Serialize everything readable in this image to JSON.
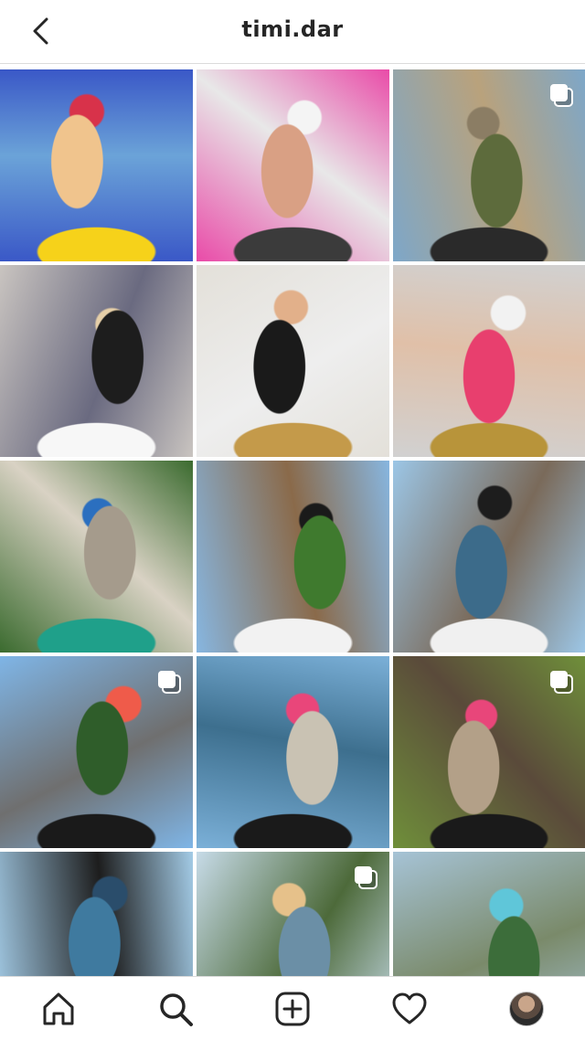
{
  "header": {
    "username": "timi.dar",
    "back_icon": "chevron-left-icon"
  },
  "grid": {
    "tiles": [
      {
        "name": "post-1",
        "multi": false,
        "colors": [
          "#3a58c7",
          "#f0c48d",
          "#d8324a",
          "#f6d21a",
          "#6ba3d8"
        ]
      },
      {
        "name": "post-2",
        "multi": false,
        "colors": [
          "#e94ba8",
          "#d9a084",
          "#f4f4f4",
          "#3b3b3b",
          "#e8e8e8"
        ]
      },
      {
        "name": "post-3",
        "multi": true,
        "colors": [
          "#7da7c9",
          "#5d6b3c",
          "#8b7d64",
          "#2a2a2a",
          "#b9a27c"
        ]
      },
      {
        "name": "post-4",
        "multi": false,
        "colors": [
          "#c9c4c0",
          "#1d1d1d",
          "#e6cfa8",
          "#f7f7f7",
          "#6a6a80"
        ]
      },
      {
        "name": "post-5",
        "multi": false,
        "colors": [
          "#e3e0d9",
          "#1a1a1a",
          "#e2b08a",
          "#c49a4a",
          "#eeeeee"
        ]
      },
      {
        "name": "post-6",
        "multi": false,
        "colors": [
          "#d1d1d1",
          "#e83f6e",
          "#f2f2f2",
          "#b8943a",
          "#e0c0a8"
        ]
      },
      {
        "name": "post-7",
        "multi": false,
        "colors": [
          "#3b6b2f",
          "#a59b8c",
          "#2b6fbf",
          "#1fa08a",
          "#d9d2c4"
        ]
      },
      {
        "name": "post-8",
        "multi": false,
        "colors": [
          "#87b6e0",
          "#3f7a2e",
          "#1a1a1a",
          "#f2f2f2",
          "#8a6a4a"
        ]
      },
      {
        "name": "post-9",
        "multi": false,
        "colors": [
          "#9cc6e6",
          "#3c6b8a",
          "#1d1d1d",
          "#f0f0f0",
          "#7a6a5a"
        ]
      },
      {
        "name": "post-10",
        "multi": true,
        "colors": [
          "#7fb5e6",
          "#2f5d2a",
          "#ef5b4a",
          "#1a1a1a",
          "#6f6f6f"
        ]
      },
      {
        "name": "post-11",
        "multi": false,
        "colors": [
          "#7bb0d8",
          "#c9c2b3",
          "#e9467a",
          "#1a1a1a",
          "#3d6f8e"
        ]
      },
      {
        "name": "post-12",
        "multi": true,
        "colors": [
          "#6f8f3a",
          "#b3a088",
          "#e8467a",
          "#1a1a1a",
          "#5a4a3a"
        ]
      },
      {
        "name": "post-13",
        "multi": false,
        "colors": [
          "#a3cbe6",
          "#3f7a9f",
          "#2a4d6b",
          "#e8c890",
          "#1d1d1d"
        ]
      },
      {
        "name": "post-14",
        "multi": true,
        "colors": [
          "#c7dbe8",
          "#6b8fa6",
          "#e6c18a",
          "#1a1a1a",
          "#4d6a3a"
        ]
      },
      {
        "name": "post-15",
        "multi": false,
        "colors": [
          "#a6c3d6",
          "#3c6d3a",
          "#5fc6d9",
          "#f2c44a",
          "#7a8a6a"
        ]
      }
    ]
  },
  "bottom_nav": {
    "items": [
      {
        "name": "home",
        "icon": "home-icon"
      },
      {
        "name": "search",
        "icon": "search-icon"
      },
      {
        "name": "create",
        "icon": "plus-square-icon"
      },
      {
        "name": "activity",
        "icon": "heart-icon"
      },
      {
        "name": "profile",
        "icon": "avatar"
      }
    ]
  }
}
